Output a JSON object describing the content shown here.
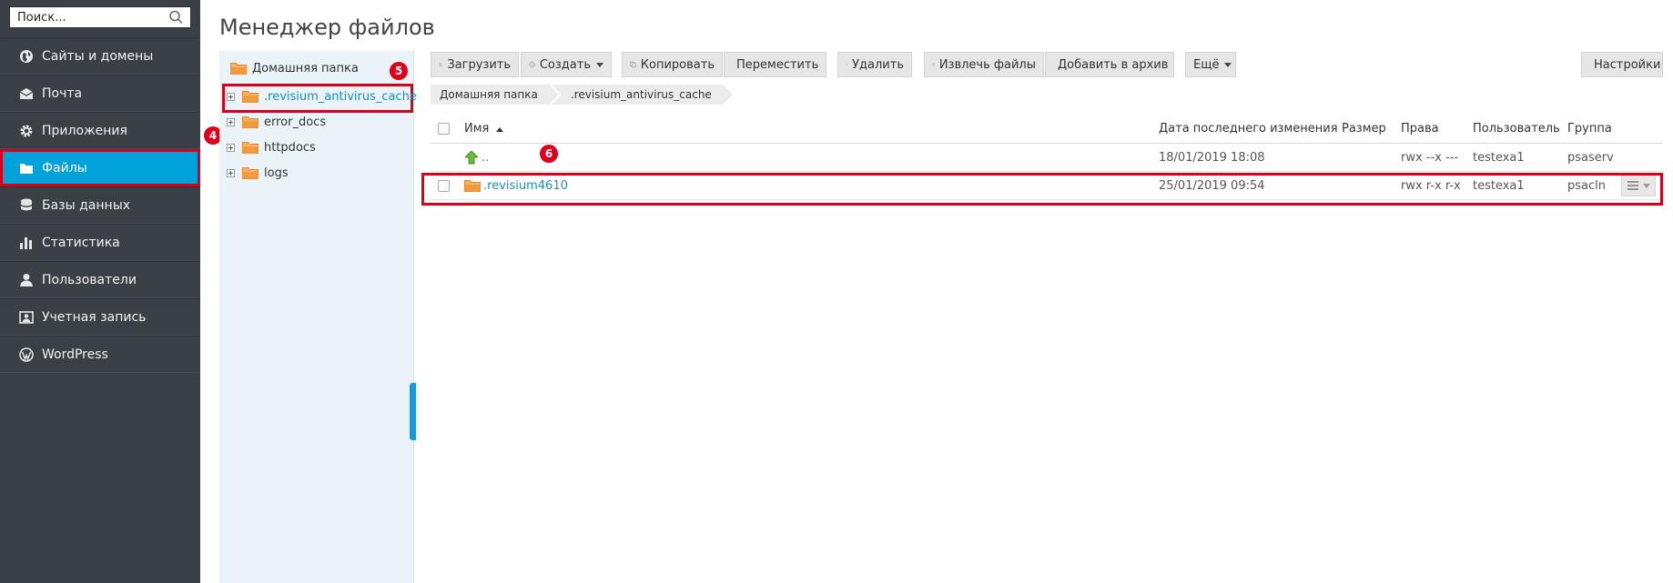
{
  "search": {
    "placeholder": "Поиск..."
  },
  "nav": {
    "items": [
      {
        "label": "Сайты и домены",
        "icon": "globe-icon"
      },
      {
        "label": "Почта",
        "icon": "mail-icon"
      },
      {
        "label": "Приложения",
        "icon": "gear-icon"
      },
      {
        "label": "Файлы",
        "icon": "folder-icon",
        "active": true
      },
      {
        "label": "Базы данных",
        "icon": "database-icon"
      },
      {
        "label": "Статистика",
        "icon": "bar-chart-icon"
      },
      {
        "label": "Пользователи",
        "icon": "user-icon"
      },
      {
        "label": "Учетная запись",
        "icon": "account-icon"
      },
      {
        "label": "WordPress",
        "icon": "wordpress-icon"
      }
    ]
  },
  "badges": {
    "b4": "4",
    "b5": "5",
    "b6": "6"
  },
  "page": {
    "title": "Менеджер файлов"
  },
  "tree": {
    "root": "Домашняя папка",
    "items": [
      {
        "label": ".revisium_antivirus_cache"
      },
      {
        "label": "error_docs"
      },
      {
        "label": "httpdocs"
      },
      {
        "label": "logs"
      }
    ]
  },
  "toolbar": {
    "upload": "Загрузить",
    "create": "Создать",
    "copy": "Копировать",
    "move": "Переместить",
    "delete": "Удалить",
    "extract": "Извлечь файлы",
    "archive": "Добавить в архив",
    "more": "Ещё",
    "settings": "Настройки"
  },
  "breadcrumb": [
    ".revisium_antivirus_cache",
    "Домашняя папка"
  ],
  "table": {
    "headers": {
      "name": "Имя",
      "modified": "Дата последнего изменения",
      "size": "Размер",
      "perms": "Права",
      "user": "Пользователь",
      "group": "Группа"
    },
    "rows": [
      {
        "name": "..",
        "modified": "18/01/2019 18:08",
        "size": "",
        "perms": "rwx --x ---",
        "user": "testexa1",
        "group": "psaserv"
      },
      {
        "name": ".revisium4610",
        "modified": "25/01/2019 09:54",
        "size": "",
        "perms": "rwx r-x r-x",
        "user": "testexa1",
        "group": "psacln"
      }
    ]
  },
  "colors": {
    "accent": "#00a3d9",
    "highlight": "#d9001b",
    "sidebar": "#3a4046",
    "folder": "#f39a3e"
  }
}
